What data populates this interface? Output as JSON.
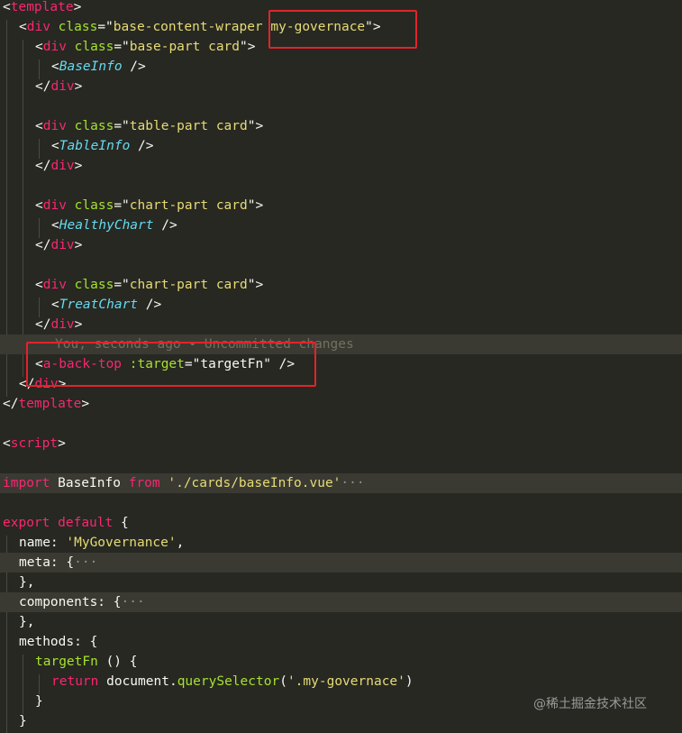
{
  "code": {
    "l1_open": "<",
    "l1_tag": "template",
    "l1_close": ">",
    "l2_open": "<",
    "l2_tag": "div",
    "l2_attr": "class",
    "l2_eq": "=\"",
    "l2_val": "base-content-wraper ",
    "l2_val2": "my-governace",
    "l2_end": "\">",
    "l3_open": "<",
    "l3_tag": "div",
    "l3_attr": "class",
    "l3_eq": "=\"",
    "l3_val": "base-part card",
    "l3_end": "\">",
    "l4_open": "<",
    "l4_comp": "BaseInfo",
    "l4_end": " />",
    "l5_open": "</",
    "l5_tag": "div",
    "l5_end": ">",
    "l7_open": "<",
    "l7_tag": "div",
    "l7_attr": "class",
    "l7_eq": "=\"",
    "l7_val": "table-part card",
    "l7_end": "\">",
    "l8_open": "<",
    "l8_comp": "TableInfo",
    "l8_end": " />",
    "l9_open": "</",
    "l9_tag": "div",
    "l9_end": ">",
    "l11_open": "<",
    "l11_tag": "div",
    "l11_attr": "class",
    "l11_eq": "=\"",
    "l11_val": "chart-part card",
    "l11_end": "\">",
    "l12_open": "<",
    "l12_comp": "HealthyChart",
    "l12_end": " />",
    "l13_open": "</",
    "l13_tag": "div",
    "l13_end": ">",
    "l15_open": "<",
    "l15_tag": "div",
    "l15_attr": "class",
    "l15_eq": "=\"",
    "l15_val": "chart-part card",
    "l15_end": "\">",
    "l16_open": "<",
    "l16_comp": "TreatChart",
    "l16_end": " />",
    "l17_open": "</",
    "l17_tag": "div",
    "l17_end": ">",
    "l18_ghost": "You, seconds ago • Uncommitted changes",
    "l19_open": "<",
    "l19_tag": "a-back-top",
    "l19_attr": " :target",
    "l19_eq": "=\"",
    "l19_val": "targetFn",
    "l19_end": "\" />",
    "l20_open": "</",
    "l20_tag": "div",
    "l20_end": ">",
    "l21_open": "</",
    "l21_tag": "template",
    "l21_end": ">",
    "l23_open": "<",
    "l23_tag": "script",
    "l23_end": ">",
    "l25_kw": "import",
    "l25_name": " BaseInfo ",
    "l25_from": "from",
    "l25_sp": " ",
    "l25_str": "'./cards/baseInfo.vue'",
    "l25_fold": "···",
    "l27_kw1": "export",
    "l27_sp": " ",
    "l27_kw2": "default",
    "l27_brace": " {",
    "l28_key": "name: ",
    "l28_str": "'MyGovernance'",
    "l28_end": ",",
    "l29_key": "meta: {",
    "l29_fold": "···",
    "l30_text": "},",
    "l31_key": "components: {",
    "l31_fold": "···",
    "l32_text": "},",
    "l33_key": "methods: {",
    "l34_fn": "targetFn",
    "l34_rest": " () {",
    "l35_kw": "return",
    "l35_obj": " document.",
    "l35_fn": "querySelector",
    "l35_p1": "(",
    "l35_str": "'.my-governace'",
    "l35_p2": ")",
    "l36_text": "}",
    "l37_text": "}"
  },
  "watermark": "@稀土掘金技术社区",
  "colors": {
    "background": "#272822",
    "tag": "#f92672",
    "attribute": "#a6e22e",
    "string": "#e6db74",
    "component": "#66d9ef",
    "highlight_box": "#e0242a"
  }
}
